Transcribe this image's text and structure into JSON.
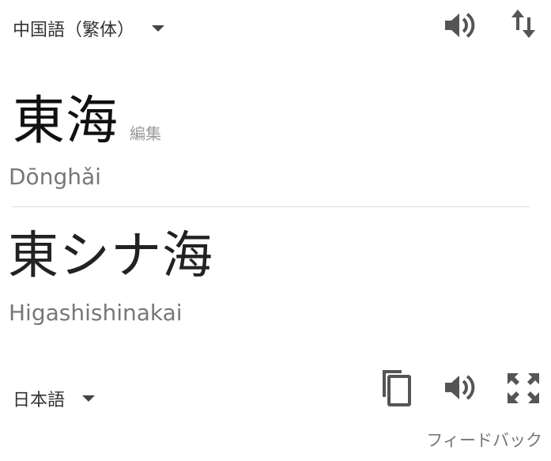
{
  "source": {
    "language": "中国語（繁体）",
    "text": "東海",
    "edit_label": "編集",
    "transliteration": "Dōnghǎi"
  },
  "target": {
    "language": "日本語",
    "text": "東シナ海",
    "transliteration": "Higashishinakai"
  },
  "feedback_label": "フィードバック",
  "icons": {
    "source_speaker": "speaker-icon",
    "swap": "swap-languages-icon",
    "copy": "copy-icon",
    "target_speaker": "speaker-icon",
    "fullscreen": "fullscreen-icon"
  }
}
